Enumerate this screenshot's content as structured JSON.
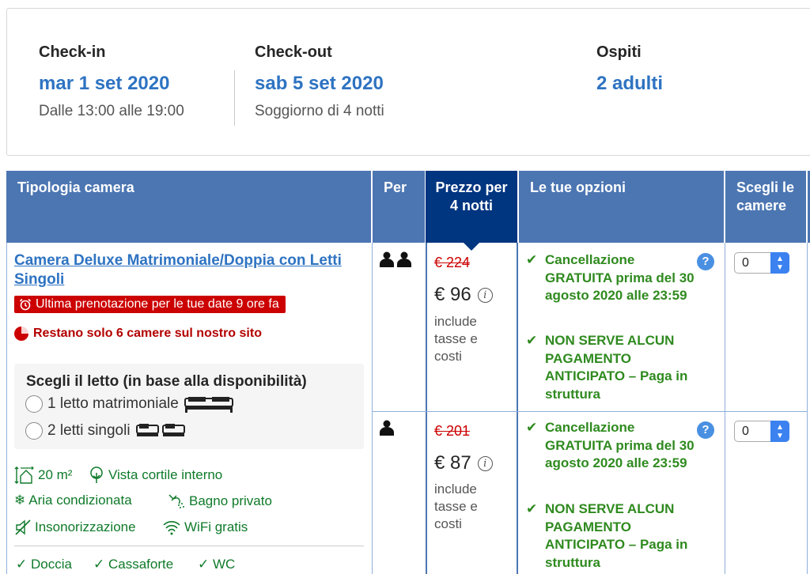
{
  "summary": {
    "checkin_label": "Check-in",
    "checkin_date": "mar 1 set 2020",
    "checkin_time": "Dalle 13:00 alle 19:00",
    "checkout_label": "Check-out",
    "checkout_date": "sab 5 set 2020",
    "checkout_stay": "Soggiorno di 4 notti",
    "guests_label": "Ospiti",
    "guests_value": "2 adulti"
  },
  "table": {
    "headers": {
      "type": "Tipologia camera",
      "per": "Per",
      "price": "Prezzo per 4 notti",
      "options": "Le tue opzioni",
      "pick": "Scegli le camere"
    }
  },
  "room": {
    "name": "Camera Deluxe Matrimoniale/Doppia con Letti Singoli",
    "urgency": "Ultima prenotazione per le tue date 9 ore fa",
    "rooms_left": "Restano solo 6 camere sul nostro sito",
    "bed_title": "Scegli il letto (in base alla disponibilità)",
    "bed_options": [
      "1 letto matrimoniale",
      "2 letti singoli"
    ],
    "facilities": [
      "20 m²",
      "Vista cortile interno",
      "Aria condizionata",
      "Bagno privato",
      "Insonorizzazione",
      "WiFi gratis"
    ],
    "includes": [
      "Doccia",
      "Cassaforte",
      "WC"
    ]
  },
  "rates": [
    {
      "old_price": "€ 224",
      "price": "€ 96",
      "taxes": "include tasse e costi",
      "cancellation": "Cancellazione GRATUITA prima del 30 agosto 2020 alle 23:59",
      "payment": "NON SERVE ALCUN PAGAMENTO ANTICIPATO – Paga in struttura",
      "quantity": "0"
    },
    {
      "old_price": "€ 201",
      "price": "€ 87",
      "taxes": "include tasse e costi",
      "cancellation": "Cancellazione GRATUITA prima del 30 agosto 2020 alle 23:59",
      "payment": "NON SERVE ALCUN PAGAMENTO ANTICIPATO – Paga in struttura",
      "quantity": "0"
    }
  ],
  "colors": {
    "link_blue": "#2e73c2",
    "header_blue": "#4c76b2",
    "price_header_navy": "#003580",
    "green": "#2f8a1f",
    "red": "#cc0000"
  }
}
